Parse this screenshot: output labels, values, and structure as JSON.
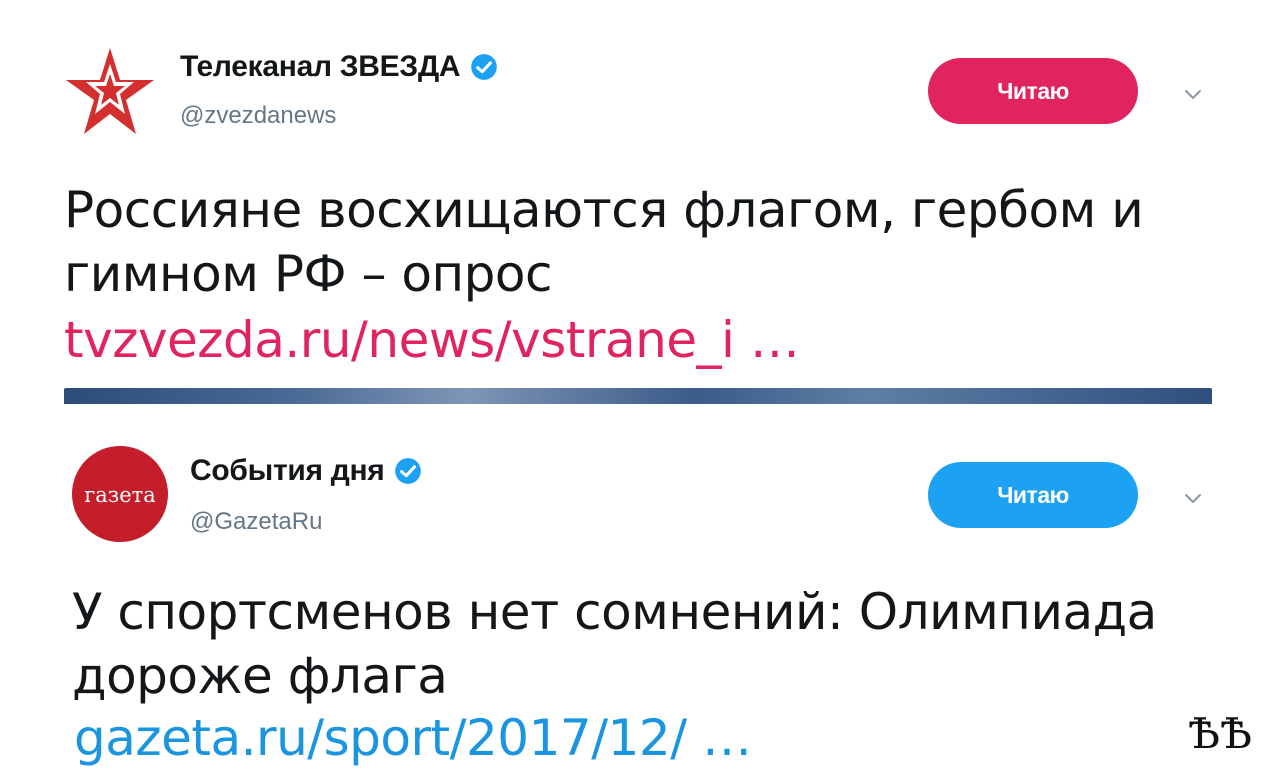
{
  "tweets": [
    {
      "display_name": "Телеканал ЗВЕЗДА",
      "handle": "@zvezdanews",
      "follow_label": "Читаю",
      "follow_color": "#e0245e",
      "avatar_icon": "red-star-logo-icon",
      "text": [
        "Россияне восхищаются флагом, гербом и",
        "гимном РФ – опрос"
      ],
      "link": "tvzvezda.ru/news/vstrane_i …",
      "link_color": "#e0245e"
    },
    {
      "display_name": "События дня",
      "handle": "@GazetaRu",
      "follow_label": "Читаю",
      "follow_color": "#1da1f2",
      "avatar_icon": "gazeta-logo-icon",
      "avatar_text": "газета",
      "text": [
        "У спортсменов нет сомнений: Олимпиада",
        "дороже флага"
      ],
      "link": "gazeta.ru/sport/2017/12/ …",
      "link_color": "#1b95e0"
    }
  ],
  "watermark": "ѢѢ",
  "colors": {
    "verified": "#1da1f2",
    "handle": "#657786"
  }
}
